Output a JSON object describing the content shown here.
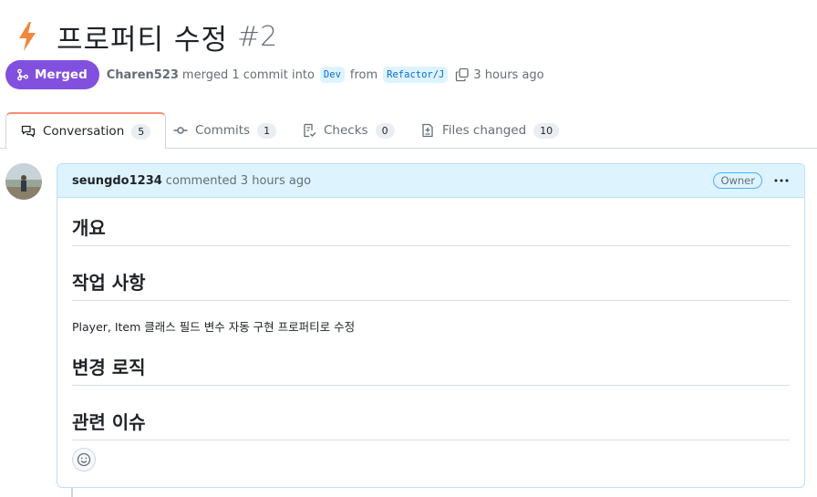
{
  "pr": {
    "title": "프로퍼티 수정",
    "number": "#2",
    "title_icon": "lightning-bolt-icon",
    "accent": "#f0883e"
  },
  "meta": {
    "state": "Merged",
    "state_color": "#8250df",
    "author": "Charen523",
    "merged_text": "merged 1 commit into",
    "base_branch": "Dev",
    "from_text": "from",
    "head_branch": "Refactor/J",
    "time": "3 hours ago"
  },
  "tabs": [
    {
      "label": "Conversation",
      "count": "5",
      "icon": "comment-discussion-icon"
    },
    {
      "label": "Commits",
      "count": "1",
      "icon": "commit-icon"
    },
    {
      "label": "Checks",
      "count": "0",
      "icon": "checklist-icon"
    },
    {
      "label": "Files changed",
      "count": "10",
      "icon": "file-diff-icon"
    }
  ],
  "comment": {
    "author": "seungdo1234",
    "action": "commented",
    "time": "3 hours ago",
    "badge": "Owner",
    "sections": [
      {
        "heading": "개요"
      },
      {
        "heading": "작업 사항",
        "text": "Player, Item 클래스 필드 변수 자동 구현 프로퍼티로 수정"
      },
      {
        "heading": "변경 로직"
      },
      {
        "heading": "관련 이슈"
      }
    ]
  }
}
